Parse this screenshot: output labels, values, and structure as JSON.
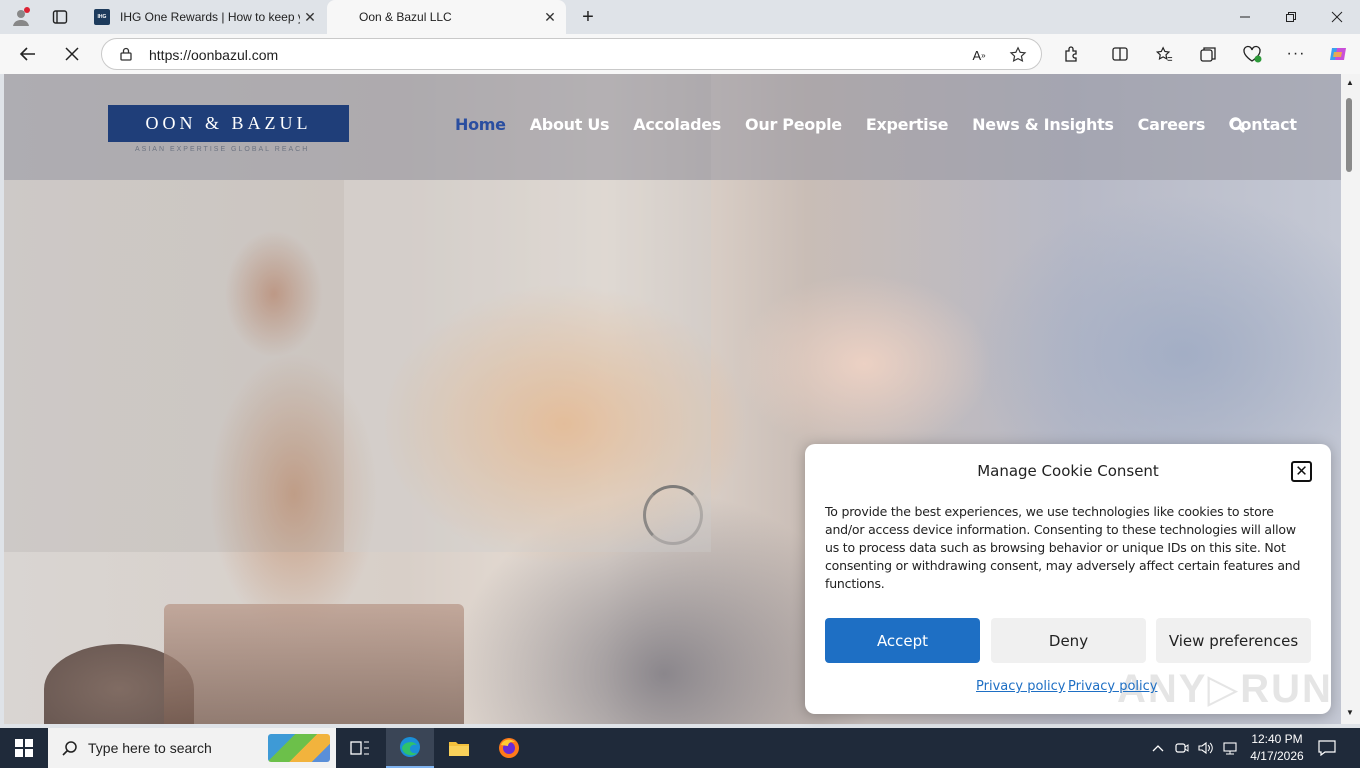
{
  "browser": {
    "tabs": [
      {
        "title": "IHG One Rewards | How to keep y",
        "active": false
      },
      {
        "title": "Oon & Bazul LLC",
        "active": true
      }
    ],
    "url": "https://oonbazul.com"
  },
  "site": {
    "logo_text": "OON & BAZUL",
    "logo_tagline": "ASIAN EXPERTISE GLOBAL REACH",
    "nav": [
      "Home",
      "About Us",
      "Accolades",
      "Our People",
      "Expertise",
      "News & Insights",
      "Careers",
      "Contact"
    ],
    "active_nav": "Home"
  },
  "cookie": {
    "title": "Manage Cookie Consent",
    "text": "To provide the best experiences, we use technologies like cookies to store and/or access device information. Consenting to these technologies will allow us to process data such as browsing behavior or unique IDs on this site. Not consenting or withdrawing consent, may adversely affect certain features and functions.",
    "accept": "Accept",
    "deny": "Deny",
    "preferences": "View preferences",
    "privacy_link_1": "Privacy policy",
    "privacy_link_2": "Privacy policy"
  },
  "taskbar": {
    "search_placeholder": "Type here to search",
    "time": "12:40 PM",
    "date": "4/17/2026"
  },
  "colors": {
    "accept_button": "#1e6fc4",
    "logo_bg": "#1f3e79",
    "active_nav": "#2a4ea0",
    "taskbar": "#1f2a3a"
  }
}
